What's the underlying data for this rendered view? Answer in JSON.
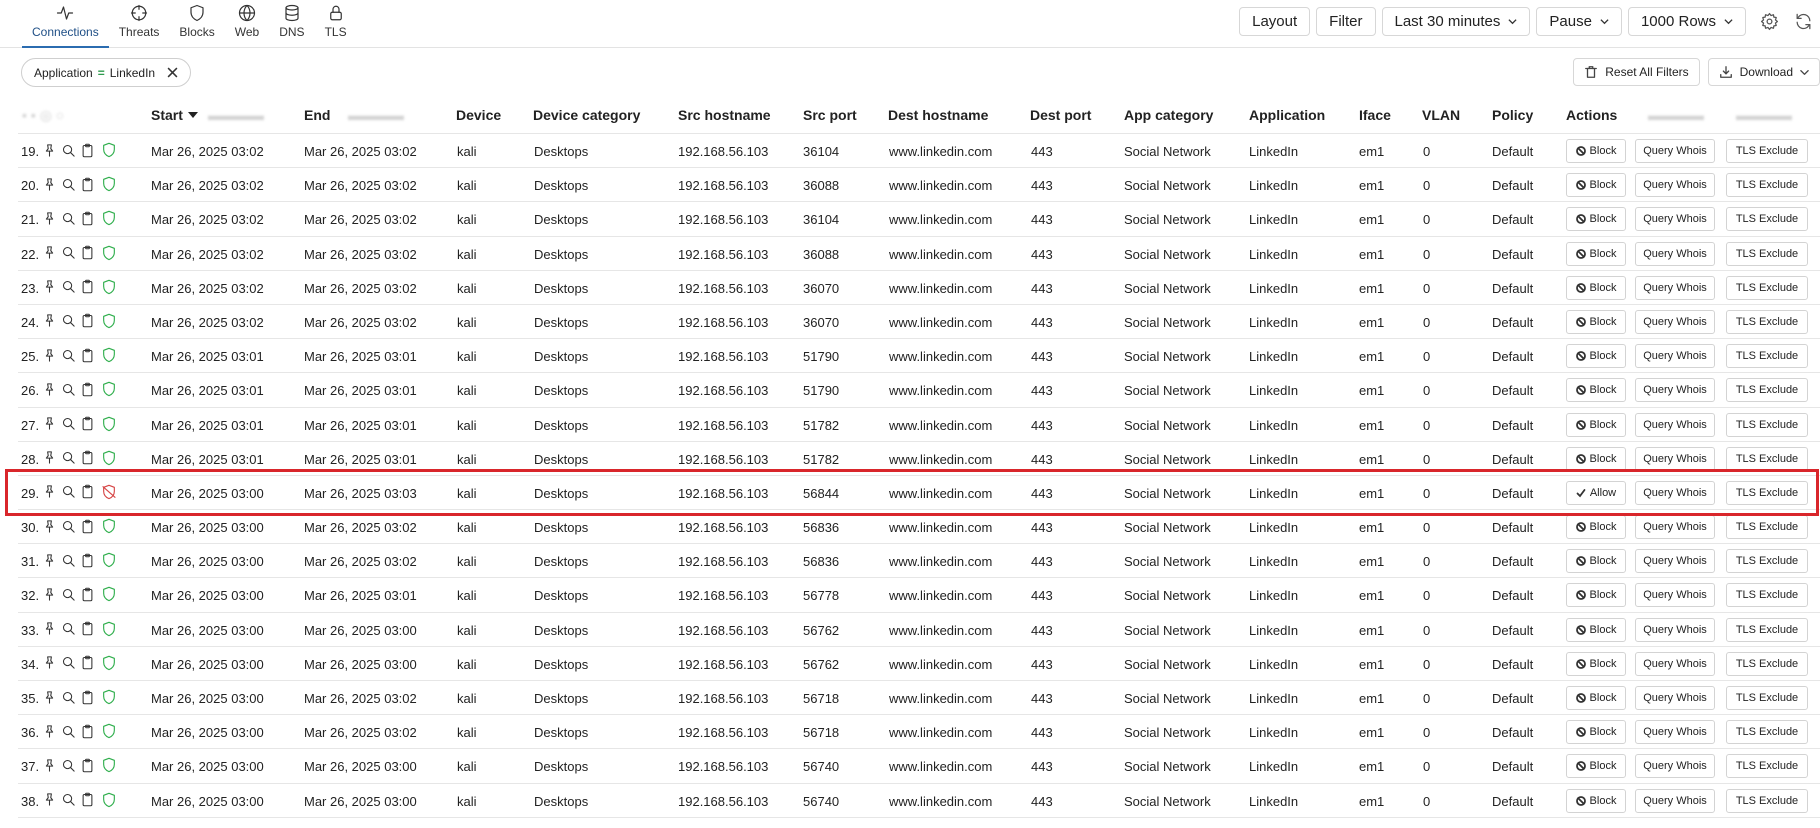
{
  "tabs": [
    {
      "label": "Connections",
      "icon": "activity-icon",
      "active": true
    },
    {
      "label": "Threats",
      "icon": "crosshair-icon",
      "active": false
    },
    {
      "label": "Blocks",
      "icon": "shield-icon",
      "active": false
    },
    {
      "label": "Web",
      "icon": "globe-icon",
      "active": false
    },
    {
      "label": "DNS",
      "icon": "database-icon",
      "active": false
    },
    {
      "label": "TLS",
      "icon": "lock-icon",
      "active": false
    }
  ],
  "toolbar": {
    "layout_label": "Layout",
    "filter_label": "Filter",
    "range_label": "Last 30 minutes",
    "pause_label": "Pause",
    "rows_label": "1000 Rows"
  },
  "filter_chip": {
    "field": "Application",
    "operator": "=",
    "value": "LinkedIn"
  },
  "actions": {
    "reset_label": "Reset All Filters",
    "download_label": "Download"
  },
  "columns": {
    "start": "Start",
    "end": "End",
    "device": "Device",
    "device_category": "Device category",
    "src_hostname": "Src hostname",
    "src_port": "Src port",
    "dest_hostname": "Dest hostname",
    "dest_port": "Dest port",
    "app_category": "App category",
    "application": "Application",
    "iface": "Iface",
    "vlan": "VLAN",
    "policy": "Policy",
    "actions": "Actions"
  },
  "row_buttons": {
    "block": "Block",
    "allow": "Allow",
    "whois": "Query Whois",
    "tls_exclude": "TLS Exclude"
  },
  "colors": {
    "accent": "#2b6cb0",
    "shield_ok": "#2fae4c",
    "shield_blocked": "#d64545",
    "highlight": "#d9262b"
  },
  "rows": [
    {
      "idx": "19.",
      "start": "Mar 26, 2025 03:02",
      "end": "Mar 26, 2025 03:02",
      "device": "kali",
      "device_category": "Desktops",
      "src_hostname": "192.168.56.103",
      "src_port": "36104",
      "dest_hostname": "www.linkedin.com",
      "dest_port": "443",
      "app_category": "Social Network",
      "application": "LinkedIn",
      "iface": "em1",
      "vlan": "0",
      "policy": "Default",
      "blocked": false
    },
    {
      "idx": "20.",
      "start": "Mar 26, 2025 03:02",
      "end": "Mar 26, 2025 03:02",
      "device": "kali",
      "device_category": "Desktops",
      "src_hostname": "192.168.56.103",
      "src_port": "36088",
      "dest_hostname": "www.linkedin.com",
      "dest_port": "443",
      "app_category": "Social Network",
      "application": "LinkedIn",
      "iface": "em1",
      "vlan": "0",
      "policy": "Default",
      "blocked": false
    },
    {
      "idx": "21.",
      "start": "Mar 26, 2025 03:02",
      "end": "Mar 26, 2025 03:02",
      "device": "kali",
      "device_category": "Desktops",
      "src_hostname": "192.168.56.103",
      "src_port": "36104",
      "dest_hostname": "www.linkedin.com",
      "dest_port": "443",
      "app_category": "Social Network",
      "application": "LinkedIn",
      "iface": "em1",
      "vlan": "0",
      "policy": "Default",
      "blocked": false
    },
    {
      "idx": "22.",
      "start": "Mar 26, 2025 03:02",
      "end": "Mar 26, 2025 03:02",
      "device": "kali",
      "device_category": "Desktops",
      "src_hostname": "192.168.56.103",
      "src_port": "36088",
      "dest_hostname": "www.linkedin.com",
      "dest_port": "443",
      "app_category": "Social Network",
      "application": "LinkedIn",
      "iface": "em1",
      "vlan": "0",
      "policy": "Default",
      "blocked": false
    },
    {
      "idx": "23.",
      "start": "Mar 26, 2025 03:02",
      "end": "Mar 26, 2025 03:02",
      "device": "kali",
      "device_category": "Desktops",
      "src_hostname": "192.168.56.103",
      "src_port": "36070",
      "dest_hostname": "www.linkedin.com",
      "dest_port": "443",
      "app_category": "Social Network",
      "application": "LinkedIn",
      "iface": "em1",
      "vlan": "0",
      "policy": "Default",
      "blocked": false
    },
    {
      "idx": "24.",
      "start": "Mar 26, 2025 03:02",
      "end": "Mar 26, 2025 03:02",
      "device": "kali",
      "device_category": "Desktops",
      "src_hostname": "192.168.56.103",
      "src_port": "36070",
      "dest_hostname": "www.linkedin.com",
      "dest_port": "443",
      "app_category": "Social Network",
      "application": "LinkedIn",
      "iface": "em1",
      "vlan": "0",
      "policy": "Default",
      "blocked": false
    },
    {
      "idx": "25.",
      "start": "Mar 26, 2025 03:01",
      "end": "Mar 26, 2025 03:01",
      "device": "kali",
      "device_category": "Desktops",
      "src_hostname": "192.168.56.103",
      "src_port": "51790",
      "dest_hostname": "www.linkedin.com",
      "dest_port": "443",
      "app_category": "Social Network",
      "application": "LinkedIn",
      "iface": "em1",
      "vlan": "0",
      "policy": "Default",
      "blocked": false
    },
    {
      "idx": "26.",
      "start": "Mar 26, 2025 03:01",
      "end": "Mar 26, 2025 03:01",
      "device": "kali",
      "device_category": "Desktops",
      "src_hostname": "192.168.56.103",
      "src_port": "51790",
      "dest_hostname": "www.linkedin.com",
      "dest_port": "443",
      "app_category": "Social Network",
      "application": "LinkedIn",
      "iface": "em1",
      "vlan": "0",
      "policy": "Default",
      "blocked": false
    },
    {
      "idx": "27.",
      "start": "Mar 26, 2025 03:01",
      "end": "Mar 26, 2025 03:01",
      "device": "kali",
      "device_category": "Desktops",
      "src_hostname": "192.168.56.103",
      "src_port": "51782",
      "dest_hostname": "www.linkedin.com",
      "dest_port": "443",
      "app_category": "Social Network",
      "application": "LinkedIn",
      "iface": "em1",
      "vlan": "0",
      "policy": "Default",
      "blocked": false
    },
    {
      "idx": "28.",
      "start": "Mar 26, 2025 03:01",
      "end": "Mar 26, 2025 03:01",
      "device": "kali",
      "device_category": "Desktops",
      "src_hostname": "192.168.56.103",
      "src_port": "51782",
      "dest_hostname": "www.linkedin.com",
      "dest_port": "443",
      "app_category": "Social Network",
      "application": "LinkedIn",
      "iface": "em1",
      "vlan": "0",
      "policy": "Default",
      "blocked": false
    },
    {
      "idx": "29.",
      "start": "Mar 26, 2025 03:00",
      "end": "Mar 26, 2025 03:03",
      "device": "kali",
      "device_category": "Desktops",
      "src_hostname": "192.168.56.103",
      "src_port": "56844",
      "dest_hostname": "www.linkedin.com",
      "dest_port": "443",
      "app_category": "Social Network",
      "application": "LinkedIn",
      "iface": "em1",
      "vlan": "0",
      "policy": "Default",
      "blocked": true
    },
    {
      "idx": "30.",
      "start": "Mar 26, 2025 03:00",
      "end": "Mar 26, 2025 03:02",
      "device": "kali",
      "device_category": "Desktops",
      "src_hostname": "192.168.56.103",
      "src_port": "56836",
      "dest_hostname": "www.linkedin.com",
      "dest_port": "443",
      "app_category": "Social Network",
      "application": "LinkedIn",
      "iface": "em1",
      "vlan": "0",
      "policy": "Default",
      "blocked": false
    },
    {
      "idx": "31.",
      "start": "Mar 26, 2025 03:00",
      "end": "Mar 26, 2025 03:02",
      "device": "kali",
      "device_category": "Desktops",
      "src_hostname": "192.168.56.103",
      "src_port": "56836",
      "dest_hostname": "www.linkedin.com",
      "dest_port": "443",
      "app_category": "Social Network",
      "application": "LinkedIn",
      "iface": "em1",
      "vlan": "0",
      "policy": "Default",
      "blocked": false
    },
    {
      "idx": "32.",
      "start": "Mar 26, 2025 03:00",
      "end": "Mar 26, 2025 03:01",
      "device": "kali",
      "device_category": "Desktops",
      "src_hostname": "192.168.56.103",
      "src_port": "56778",
      "dest_hostname": "www.linkedin.com",
      "dest_port": "443",
      "app_category": "Social Network",
      "application": "LinkedIn",
      "iface": "em1",
      "vlan": "0",
      "policy": "Default",
      "blocked": false
    },
    {
      "idx": "33.",
      "start": "Mar 26, 2025 03:00",
      "end": "Mar 26, 2025 03:00",
      "device": "kali",
      "device_category": "Desktops",
      "src_hostname": "192.168.56.103",
      "src_port": "56762",
      "dest_hostname": "www.linkedin.com",
      "dest_port": "443",
      "app_category": "Social Network",
      "application": "LinkedIn",
      "iface": "em1",
      "vlan": "0",
      "policy": "Default",
      "blocked": false
    },
    {
      "idx": "34.",
      "start": "Mar 26, 2025 03:00",
      "end": "Mar 26, 2025 03:00",
      "device": "kali",
      "device_category": "Desktops",
      "src_hostname": "192.168.56.103",
      "src_port": "56762",
      "dest_hostname": "www.linkedin.com",
      "dest_port": "443",
      "app_category": "Social Network",
      "application": "LinkedIn",
      "iface": "em1",
      "vlan": "0",
      "policy": "Default",
      "blocked": false
    },
    {
      "idx": "35.",
      "start": "Mar 26, 2025 03:00",
      "end": "Mar 26, 2025 03:02",
      "device": "kali",
      "device_category": "Desktops",
      "src_hostname": "192.168.56.103",
      "src_port": "56718",
      "dest_hostname": "www.linkedin.com",
      "dest_port": "443",
      "app_category": "Social Network",
      "application": "LinkedIn",
      "iface": "em1",
      "vlan": "0",
      "policy": "Default",
      "blocked": false
    },
    {
      "idx": "36.",
      "start": "Mar 26, 2025 03:00",
      "end": "Mar 26, 2025 03:02",
      "device": "kali",
      "device_category": "Desktops",
      "src_hostname": "192.168.56.103",
      "src_port": "56718",
      "dest_hostname": "www.linkedin.com",
      "dest_port": "443",
      "app_category": "Social Network",
      "application": "LinkedIn",
      "iface": "em1",
      "vlan": "0",
      "policy": "Default",
      "blocked": false
    },
    {
      "idx": "37.",
      "start": "Mar 26, 2025 03:00",
      "end": "Mar 26, 2025 03:00",
      "device": "kali",
      "device_category": "Desktops",
      "src_hostname": "192.168.56.103",
      "src_port": "56740",
      "dest_hostname": "www.linkedin.com",
      "dest_port": "443",
      "app_category": "Social Network",
      "application": "LinkedIn",
      "iface": "em1",
      "vlan": "0",
      "policy": "Default",
      "blocked": false
    },
    {
      "idx": "38.",
      "start": "Mar 26, 2025 03:00",
      "end": "Mar 26, 2025 03:00",
      "device": "kali",
      "device_category": "Desktops",
      "src_hostname": "192.168.56.103",
      "src_port": "56740",
      "dest_hostname": "www.linkedin.com",
      "dest_port": "443",
      "app_category": "Social Network",
      "application": "LinkedIn",
      "iface": "em1",
      "vlan": "0",
      "policy": "Default",
      "blocked": false
    }
  ]
}
